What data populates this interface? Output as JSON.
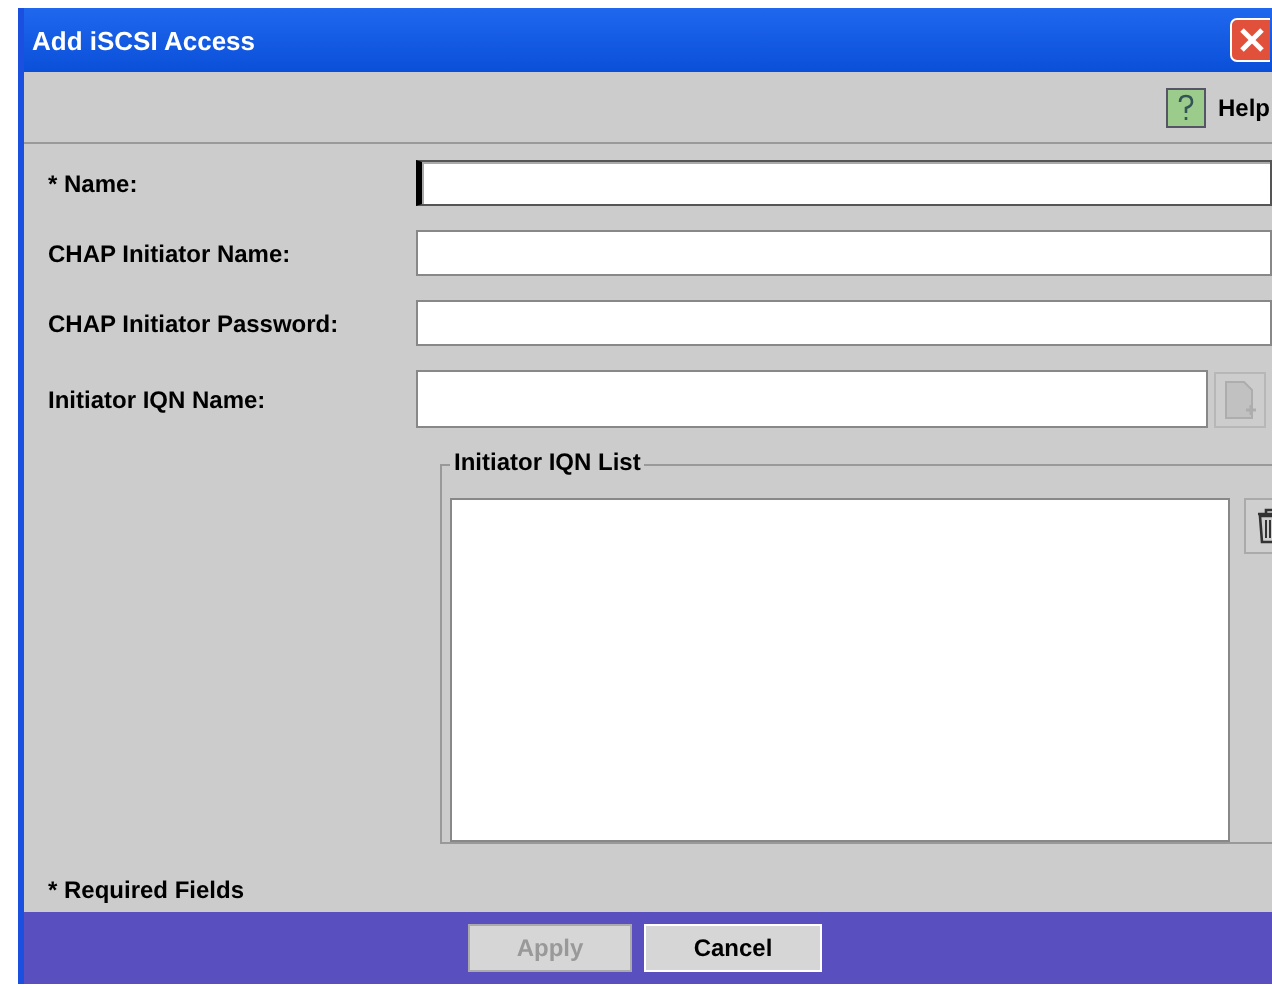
{
  "window": {
    "title": "Add iSCSI Access"
  },
  "toolbar": {
    "help": "Help"
  },
  "fields": [
    {
      "label": "* Name:",
      "focused": true
    },
    {
      "label": "CHAP Initiator Name:",
      "focused": false
    },
    {
      "label": "CHAP Initiator Password:",
      "focused": false
    }
  ],
  "iqn_name": {
    "label": "Initiator IQN Name:",
    "add_disabled": true
  },
  "iqn_list": {
    "title": "Initiator IQN List"
  },
  "footnote": "* Required Fields",
  "buttons": [
    {
      "label": "Apply",
      "disabled": true
    },
    {
      "label": "Cancel",
      "disabled": false
    }
  ]
}
